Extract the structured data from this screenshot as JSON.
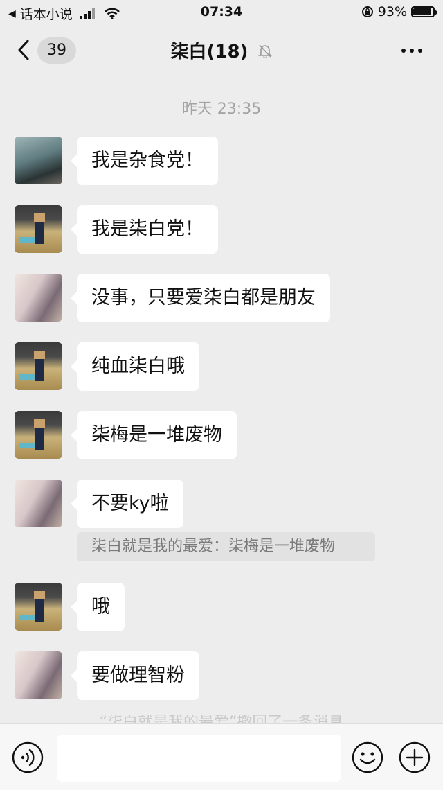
{
  "status_bar": {
    "back_app": "话本小说",
    "time": "07:34",
    "battery": "93%",
    "battery_level": 0.93
  },
  "nav": {
    "unread_count": "39",
    "title": "柒白(18)"
  },
  "chat": {
    "timestamp": "昨天 23:35",
    "messages": [
      {
        "avatar": "avatar-a",
        "text": "我是杂食党！"
      },
      {
        "avatar": "avatar-b",
        "text": "我是柒白党！"
      },
      {
        "avatar": "avatar-c",
        "text": "没事，只要爱柒白都是朋友"
      },
      {
        "avatar": "avatar-b",
        "text": "纯血柒白哦"
      },
      {
        "avatar": "avatar-b",
        "text": "柒梅是一堆废物"
      },
      {
        "avatar": "avatar-c",
        "text": "不要ky啦",
        "quote": "柒白就是我的最爱：柒梅是一堆废物"
      },
      {
        "avatar": "avatar-b",
        "text": "哦"
      },
      {
        "avatar": "avatar-c",
        "text": "要做理智粉"
      }
    ],
    "partial_notice": "“柒白就是我的最爱”撤回了一条消息"
  },
  "icons": {
    "back": "chevron-left-icon",
    "mute": "bell-off-icon",
    "more": "more-dots-icon",
    "voice": "voice-icon",
    "emoji": "emoji-icon",
    "add": "plus-icon"
  }
}
